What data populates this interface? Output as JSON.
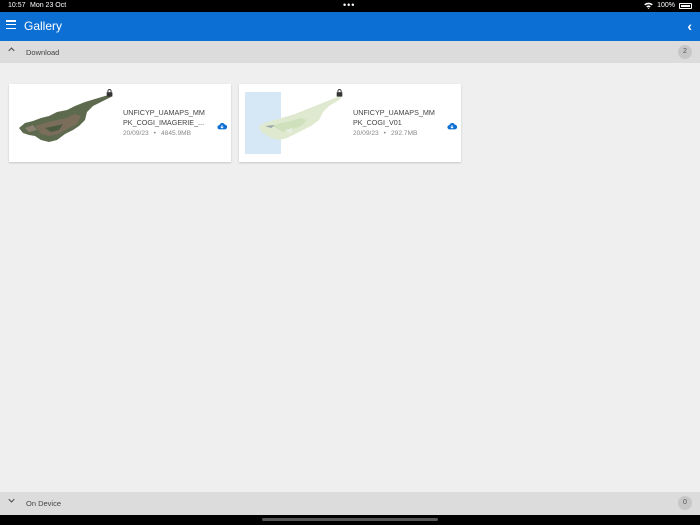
{
  "status_bar": {
    "time": "10:57",
    "date": "Mon 23 Oct",
    "battery": "100%"
  },
  "app_bar": {
    "title": "Gallery",
    "accent_color": "#0c6fd4"
  },
  "sections": {
    "download": {
      "label": "Download",
      "count": "2",
      "expanded": true
    },
    "on_device": {
      "label": "On Device",
      "count": "0",
      "expanded": false
    }
  },
  "cards": [
    {
      "title": "UNFICYP_UAMAPS_MMPK_COGI_IMAGERIE_...",
      "date": "20/09/23",
      "size": "4845.9MB",
      "locked": true,
      "thumbnail": "satellite-imagery-cyprus",
      "action_icon": "cloud-download-icon"
    },
    {
      "title": "UNFICYP_UAMAPS_MMPK_COGI_V01",
      "date": "20/09/23",
      "size": "292.7MB",
      "locked": true,
      "thumbnail": "vector-map-cyprus",
      "action_icon": "cloud-download-icon"
    }
  ]
}
